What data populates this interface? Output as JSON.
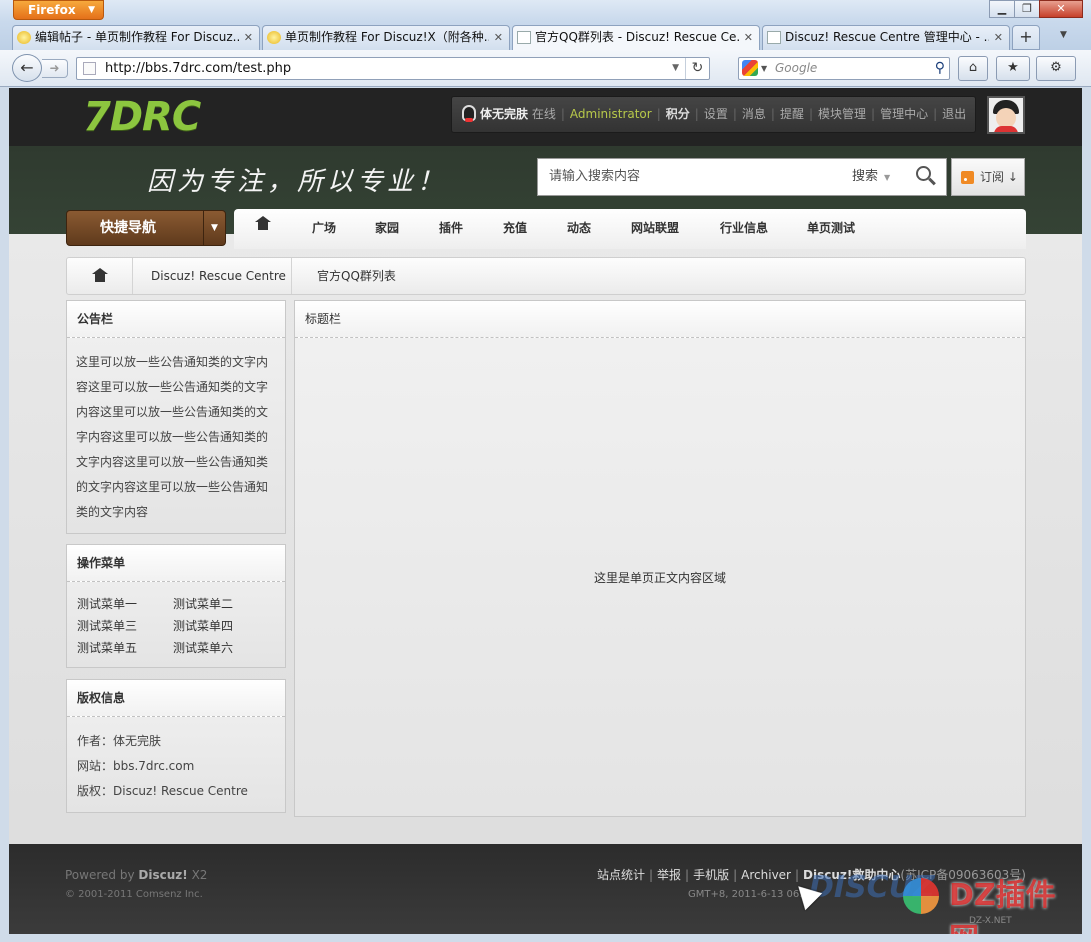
{
  "browser": {
    "app_button": "Firefox",
    "tabs": [
      {
        "label": "编辑帖子 - 单页制作教程 For Discuz...",
        "icon": "sun-icon",
        "active": false
      },
      {
        "label": "单页制作教程 For Discuz!X（附各种...",
        "icon": "sun-icon",
        "active": false
      },
      {
        "label": "官方QQ群列表 - Discuz! Rescue Ce...",
        "icon": "page-icon",
        "active": true
      },
      {
        "label": "Discuz! Rescue Centre 管理中心 - ...",
        "icon": "page-icon",
        "active": false
      }
    ],
    "url": "http://bbs.7drc.com/test.php",
    "search_placeholder": "Google"
  },
  "site": {
    "logo": "7DRC",
    "user": {
      "name": "体无完肤",
      "status": "在线",
      "group": "Administrator",
      "credits": "积分",
      "links": [
        "设置",
        "消息",
        "提醒",
        "模块管理",
        "管理中心",
        "退出"
      ]
    },
    "slogan": "因为专注，所以专业！",
    "search": {
      "placeholder": "请输入搜索内容",
      "type": "搜索"
    },
    "subscribe": "订阅",
    "quicknav": "快捷导航",
    "nav": [
      "广场",
      "家园",
      "插件",
      "充值",
      "动态",
      "网站联盟",
      "行业信息",
      "单页测试"
    ],
    "breadcrumb": [
      "Discuz! Rescue Centre",
      "官方QQ群列表"
    ]
  },
  "sidebar": {
    "notice": {
      "title": "公告栏",
      "lines": [
        "这里可以放一些公告通知类的文字内",
        "容这里可以放一些公告通知类的文字",
        "内容这里可以放一些公告通知类的文",
        "字内容这里可以放一些公告通知类的",
        "文字内容这里可以放一些公告通知类",
        "的文字内容这里可以放一些公告通知",
        "类的文字内容"
      ]
    },
    "menu": {
      "title": "操作菜单",
      "items": [
        "测试菜单一",
        "测试菜单二",
        "测试菜单三",
        "测试菜单四",
        "测试菜单五",
        "测试菜单六"
      ]
    },
    "copyright": {
      "title": "版权信息",
      "lines": [
        "作者：体无完肤",
        "网站：bbs.7drc.com",
        "版权：Discuz! Rescue Centre"
      ]
    }
  },
  "content": {
    "title": "标题栏",
    "body": "这里是单页正文内容区域"
  },
  "footer": {
    "powered_prefix": "Powered by",
    "powered_name": "Discuz!",
    "powered_ver": "X2",
    "copyright": "© 2001-2011 Comsenz Inc.",
    "links": [
      "站点统计",
      "举报",
      "手机版",
      "Archiver"
    ],
    "help_link": "Discuz!救助中心",
    "icp": "(苏ICP备09063603号)",
    "time": "GMT+8, 2011-6-13 06:4",
    "watermark_a": "DISCUZ",
    "watermark_b": "DZ插件网",
    "watermark_sub": "DZ-X.NET"
  }
}
